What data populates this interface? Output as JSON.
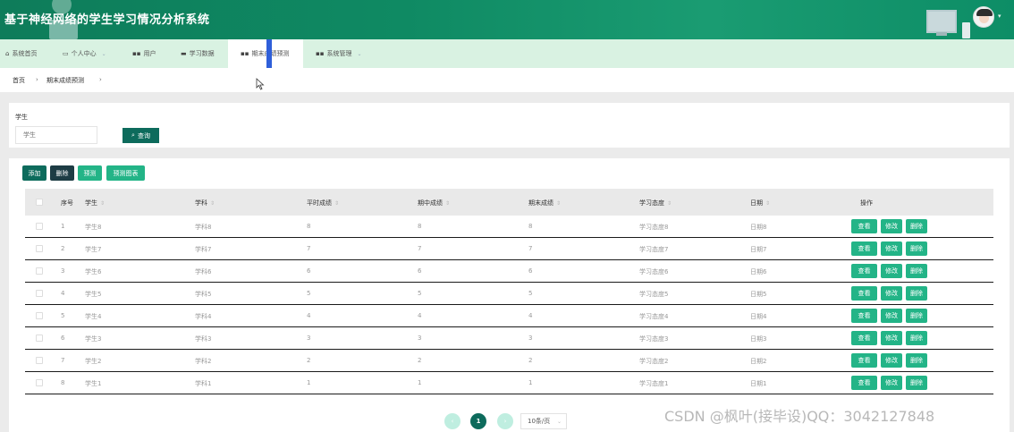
{
  "app": {
    "title": "基于神经网络的学生学习情况分析系统"
  },
  "nav": {
    "items": [
      {
        "label": "系统首页",
        "icon": "home-icon"
      },
      {
        "label": "个人中心",
        "icon": "calendar-icon",
        "caret": true
      },
      {
        "label": "用户",
        "icon": "grid-icon"
      },
      {
        "label": "学习数据",
        "icon": "chat-icon"
      },
      {
        "label": "期末成绩预测",
        "icon": "grid-icon",
        "active": true
      },
      {
        "label": "系统管理",
        "icon": "grid-icon",
        "caret": true
      }
    ]
  },
  "breadcrumb": {
    "home": "首页",
    "current": "期末成绩预测"
  },
  "search": {
    "label": "学生",
    "placeholder": "学生",
    "button": "查询"
  },
  "toolbar": {
    "add": "添加",
    "delete": "删除",
    "predict": "预测",
    "chart": "预测图表"
  },
  "table": {
    "columns": [
      "序号",
      "学生",
      "学科",
      "平时成绩",
      "期中成绩",
      "期末成绩",
      "学习态度",
      "日期",
      "操作"
    ],
    "rows": [
      {
        "idx": "1",
        "student": "学生8",
        "subject": "学科8",
        "usual": "8",
        "mid": "8",
        "final": "8",
        "attitude": "学习态度8",
        "date": "日期8"
      },
      {
        "idx": "2",
        "student": "学生7",
        "subject": "学科7",
        "usual": "7",
        "mid": "7",
        "final": "7",
        "attitude": "学习态度7",
        "date": "日期7"
      },
      {
        "idx": "3",
        "student": "学生6",
        "subject": "学科6",
        "usual": "6",
        "mid": "6",
        "final": "6",
        "attitude": "学习态度6",
        "date": "日期6"
      },
      {
        "idx": "4",
        "student": "学生5",
        "subject": "学科5",
        "usual": "5",
        "mid": "5",
        "final": "5",
        "attitude": "学习态度5",
        "date": "日期5"
      },
      {
        "idx": "5",
        "student": "学生4",
        "subject": "学科4",
        "usual": "4",
        "mid": "4",
        "final": "4",
        "attitude": "学习态度4",
        "date": "日期4"
      },
      {
        "idx": "6",
        "student": "学生3",
        "subject": "学科3",
        "usual": "3",
        "mid": "3",
        "final": "3",
        "attitude": "学习态度3",
        "date": "日期3"
      },
      {
        "idx": "7",
        "student": "学生2",
        "subject": "学科2",
        "usual": "2",
        "mid": "2",
        "final": "2",
        "attitude": "学习态度2",
        "date": "日期2"
      },
      {
        "idx": "8",
        "student": "学生1",
        "subject": "学科1",
        "usual": "1",
        "mid": "1",
        "final": "1",
        "attitude": "学习态度1",
        "date": "日期1"
      }
    ],
    "actions": {
      "view": "查看",
      "edit": "修改",
      "delete": "删除"
    }
  },
  "pagination": {
    "current": "1",
    "page_size": "10条/页"
  },
  "watermark": "CSDN @枫叶(接毕设)QQ：3042127848",
  "colors": {
    "primary": "#0d6b5c",
    "accent": "#23b487",
    "header": "#0f8a63",
    "nav_bg": "#d9f2e2"
  }
}
